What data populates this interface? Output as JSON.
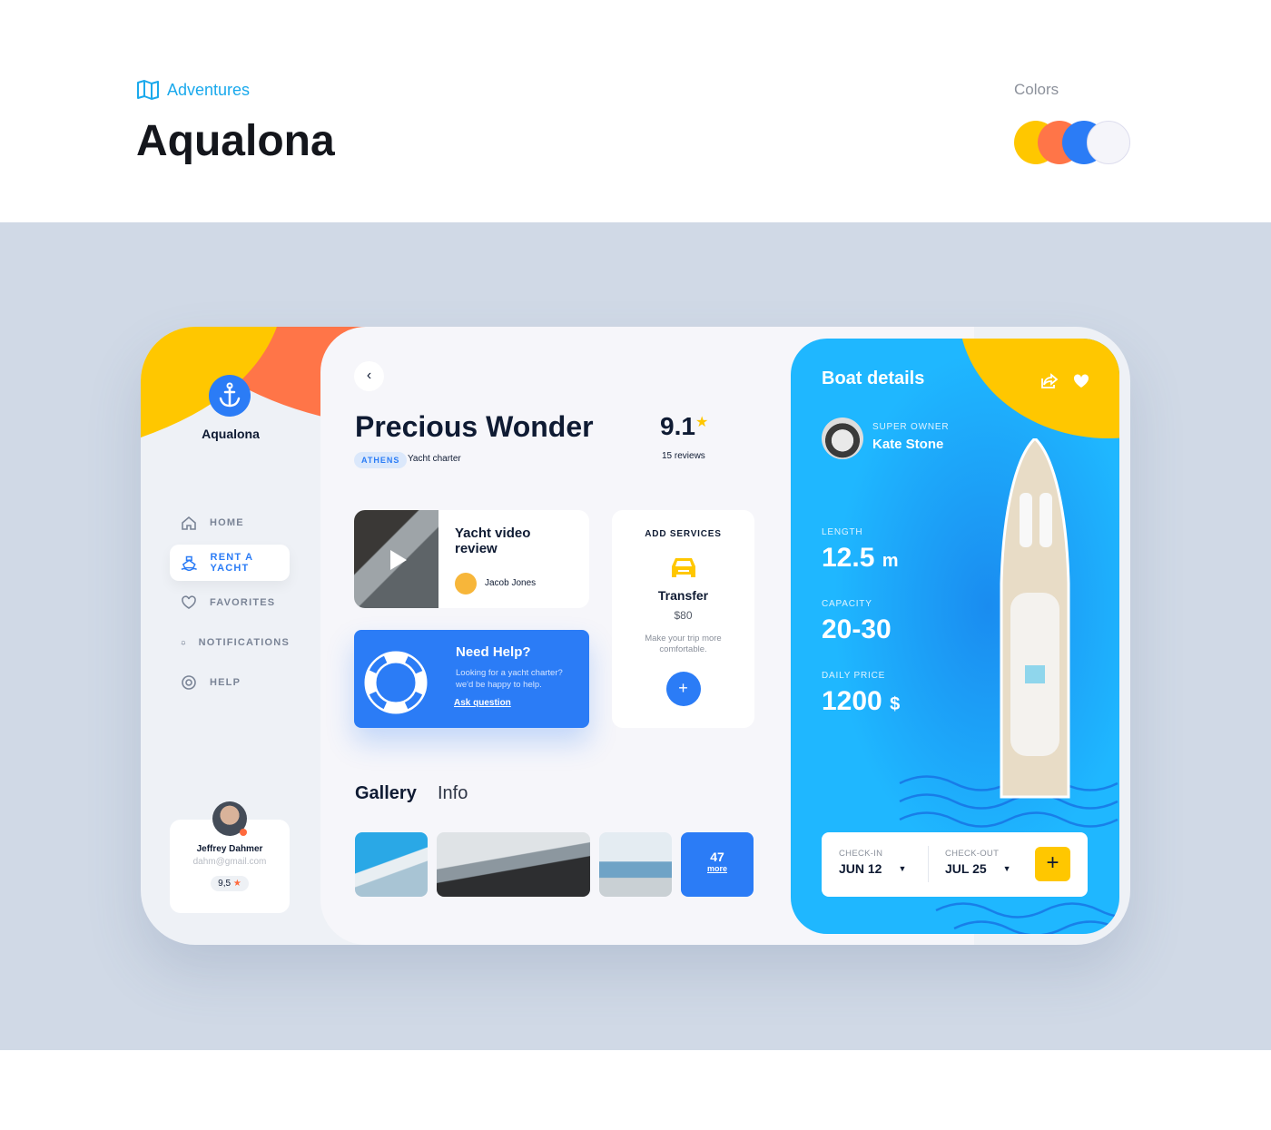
{
  "header": {
    "category": "Adventures",
    "title": "Aqualona",
    "colors_label": "Colors",
    "palette": [
      "#FFC700",
      "#FF7548",
      "#2B7CF6",
      "#F5F5FA"
    ]
  },
  "sidebar": {
    "brand": "Aqualona",
    "items": [
      {
        "label": "HOME",
        "icon": "home-icon"
      },
      {
        "label": "RENT A YACHT",
        "icon": "ship-icon",
        "active": true
      },
      {
        "label": "FAVORITES",
        "icon": "heart-icon"
      },
      {
        "label": "NOTIFICATIONS",
        "icon": "bell-icon"
      },
      {
        "label": "HELP",
        "icon": "lifebuoy-icon"
      }
    ],
    "user": {
      "name": "Jeffrey Dahmer",
      "email": "dahm@gmail.com",
      "rating": "9,5"
    }
  },
  "main": {
    "title": "Precious Wonder",
    "tag": "ATHENS",
    "subtitle": "Yacht charter",
    "rating": "9.1",
    "reviews": "15 reviews",
    "video": {
      "title_line1": "Yacht video",
      "title_line2": "review",
      "author": "Jacob Jones"
    },
    "help": {
      "title": "Need Help?",
      "line1": "Looking for a yacht charter?",
      "line2": "we'd be happy to help.",
      "link": "Ask question"
    },
    "services": {
      "heading": "ADD SERVICES",
      "name": "Transfer",
      "price": "$80",
      "desc_line1": "Make your trip more",
      "desc_line2": "comfortable."
    },
    "tabs": [
      {
        "label": "Gallery",
        "active": true
      },
      {
        "label": "Info"
      }
    ],
    "gallery": {
      "more_count": "47",
      "more_label": "more"
    }
  },
  "details": {
    "title": "Boat details",
    "owner_label": "SUPER OWNER",
    "owner_name": "Kate Stone",
    "length_label": "LENGTH",
    "length": "12.5",
    "length_unit": "m",
    "capacity_label": "CAPACITY",
    "capacity": "20-30",
    "price_label": "DAILY PRICE",
    "price": "1200",
    "price_unit": "$",
    "checkin_label": "CHECK-IN",
    "checkin": "JUN 12",
    "checkout_label": "CHECK-OUT",
    "checkout": "JUL 25"
  }
}
